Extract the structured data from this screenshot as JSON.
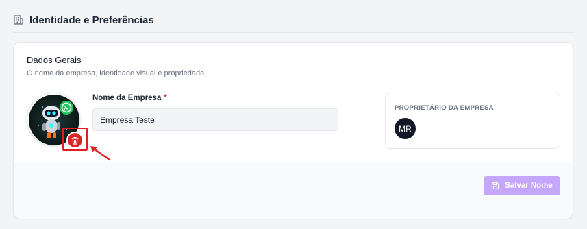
{
  "header": {
    "icon": "building-icon",
    "title": "Identidade e Preferências"
  },
  "card": {
    "title": "Dados Gerais",
    "description": "O nome da empresa, identidade visual e propriedade."
  },
  "logo": {
    "icon": "robot-logo",
    "delete_icon": "trash-icon",
    "delete_color": "#dc2626",
    "annotation_color": "#e11d1d"
  },
  "company_name": {
    "label": "Nome da Empresa",
    "required_mark": "*",
    "value": "Empresa Teste"
  },
  "owner": {
    "title": "PROPRIETÁRIO DA EMPRESA",
    "initials": "MR"
  },
  "footer": {
    "save_label": "Salvar Nome",
    "save_icon": "save-icon",
    "save_color": "#c4a6fb"
  }
}
